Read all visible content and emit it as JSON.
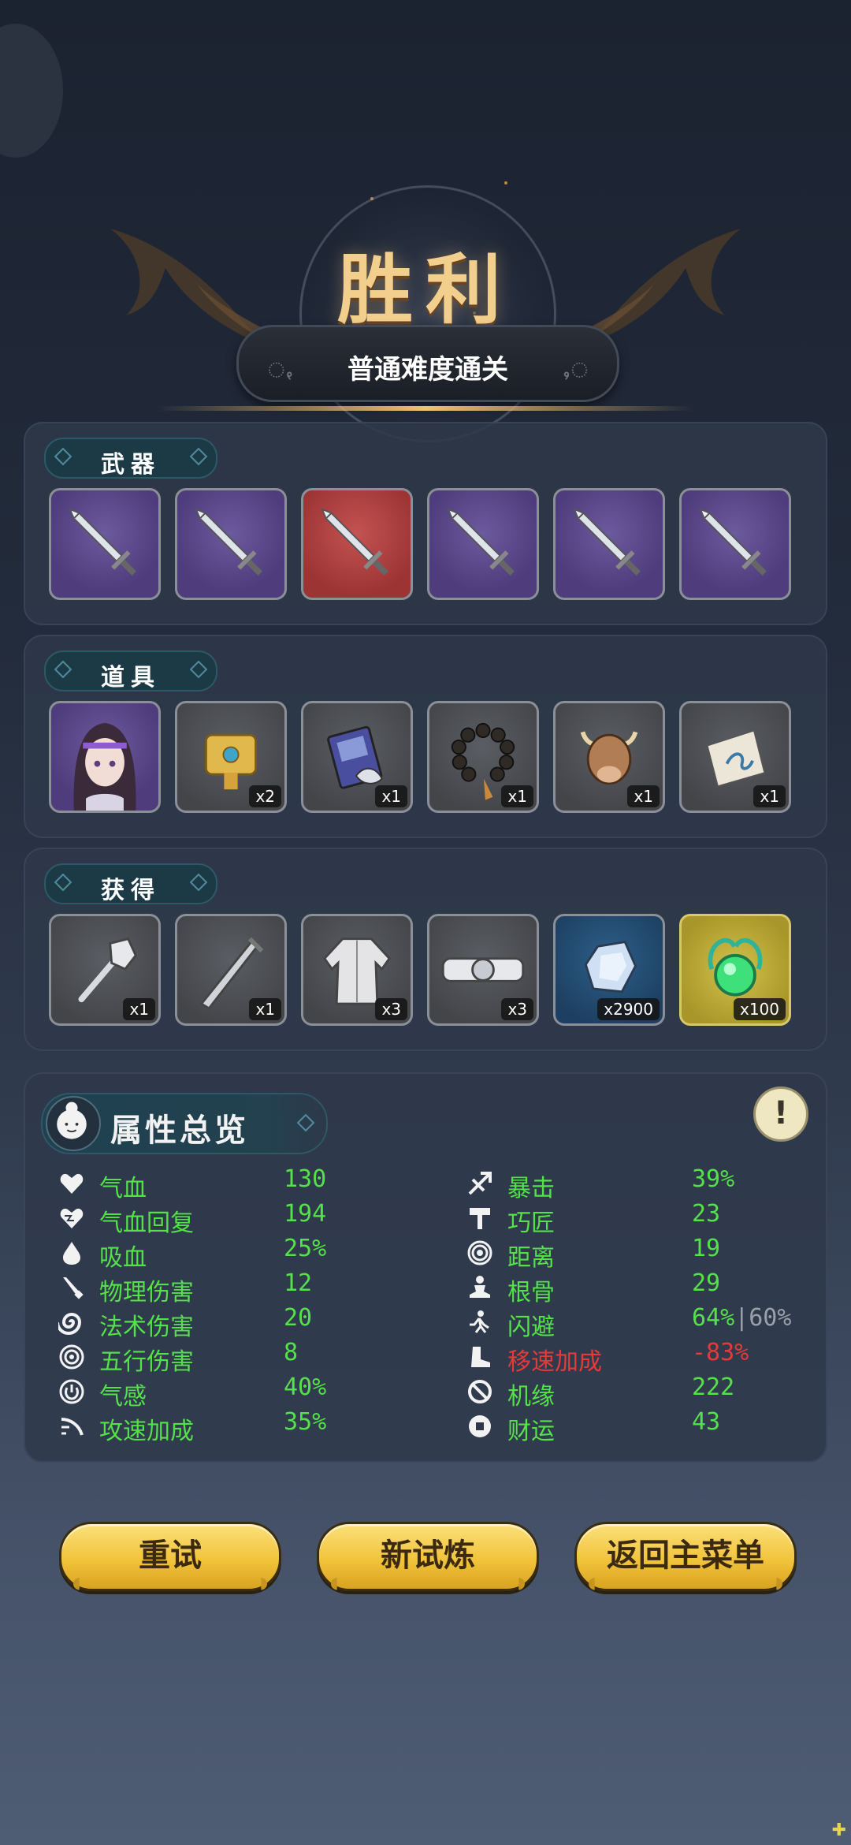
{
  "result": {
    "title": "胜利",
    "subtitle": "普通难度通关"
  },
  "sections": {
    "weapons": {
      "label": "武器",
      "items": [
        {
          "icon": "sword-icon",
          "rarity": "purple"
        },
        {
          "icon": "sword-icon",
          "rarity": "purple"
        },
        {
          "icon": "sword-icon",
          "rarity": "red"
        },
        {
          "icon": "sword-icon",
          "rarity": "purple"
        },
        {
          "icon": "sword-icon",
          "rarity": "purple"
        },
        {
          "icon": "sword-icon",
          "rarity": "purple"
        }
      ]
    },
    "props": {
      "label": "道具",
      "items": [
        {
          "icon": "character-portrait-icon",
          "qty": ""
        },
        {
          "icon": "golden-scroll-case-icon",
          "qty": "x2"
        },
        {
          "icon": "book-icon",
          "qty": "x1"
        },
        {
          "icon": "prayer-beads-icon",
          "qty": "x1"
        },
        {
          "icon": "bull-head-icon",
          "qty": "x1"
        },
        {
          "icon": "paper-talisman-icon",
          "qty": "x1"
        }
      ]
    },
    "obtained": {
      "label": "获得",
      "items": [
        {
          "icon": "mace-icon",
          "qty": "x1"
        },
        {
          "icon": "blade-icon",
          "qty": "x1"
        },
        {
          "icon": "robe-icon",
          "qty": "x3"
        },
        {
          "icon": "belt-icon",
          "qty": "x3"
        },
        {
          "icon": "crystal-icon",
          "qty": "x2900"
        },
        {
          "icon": "jade-orb-icon",
          "qty": "x100"
        }
      ]
    }
  },
  "stats": {
    "title": "属性总览",
    "info_symbol": "!",
    "left": [
      {
        "name": "气血",
        "value": "130",
        "icon": "heart-icon"
      },
      {
        "name": "气血回复",
        "value": "194",
        "icon": "heart-regen-icon"
      },
      {
        "name": "吸血",
        "value": "25%",
        "icon": "blood-drop-icon"
      },
      {
        "name": "物理伤害",
        "value": "12",
        "icon": "sword-small-icon"
      },
      {
        "name": "法术伤害",
        "value": "20",
        "icon": "spiral-icon"
      },
      {
        "name": "五行伤害",
        "value": "8",
        "icon": "rings-icon"
      },
      {
        "name": "气感",
        "value": "40%",
        "icon": "qi-icon"
      },
      {
        "name": "攻速加成",
        "value": "35%",
        "icon": "attack-speed-icon"
      }
    ],
    "right": [
      {
        "name": "暴击",
        "value": "39%",
        "cap": "",
        "icon": "crit-icon",
        "negative": false
      },
      {
        "name": "巧匠",
        "value": "23",
        "cap": "",
        "icon": "hammer-icon",
        "negative": false
      },
      {
        "name": "距离",
        "value": "19",
        "cap": "",
        "icon": "target-icon",
        "negative": false
      },
      {
        "name": "根骨",
        "value": "29",
        "cap": "",
        "icon": "meditation-icon",
        "negative": false
      },
      {
        "name": "闪避",
        "value": "64%",
        "cap": "|60%",
        "icon": "dodge-icon",
        "negative": false
      },
      {
        "name": "移速加成",
        "value": "-83%",
        "cap": "",
        "icon": "boot-icon",
        "negative": true
      },
      {
        "name": "机缘",
        "value": "222",
        "cap": "",
        "icon": "clover-icon",
        "negative": false
      },
      {
        "name": "财运",
        "value": "43",
        "cap": "",
        "icon": "coin-icon",
        "negative": false
      }
    ]
  },
  "buttons": {
    "retry": "重试",
    "new_trial": "新试炼",
    "main_menu": "返回主菜单"
  },
  "colors": {
    "stat_positive": "#55e14a",
    "stat_negative": "#e43a3a",
    "title_gold": "#f2cf8d",
    "button_yellow": "#f2c43c"
  }
}
